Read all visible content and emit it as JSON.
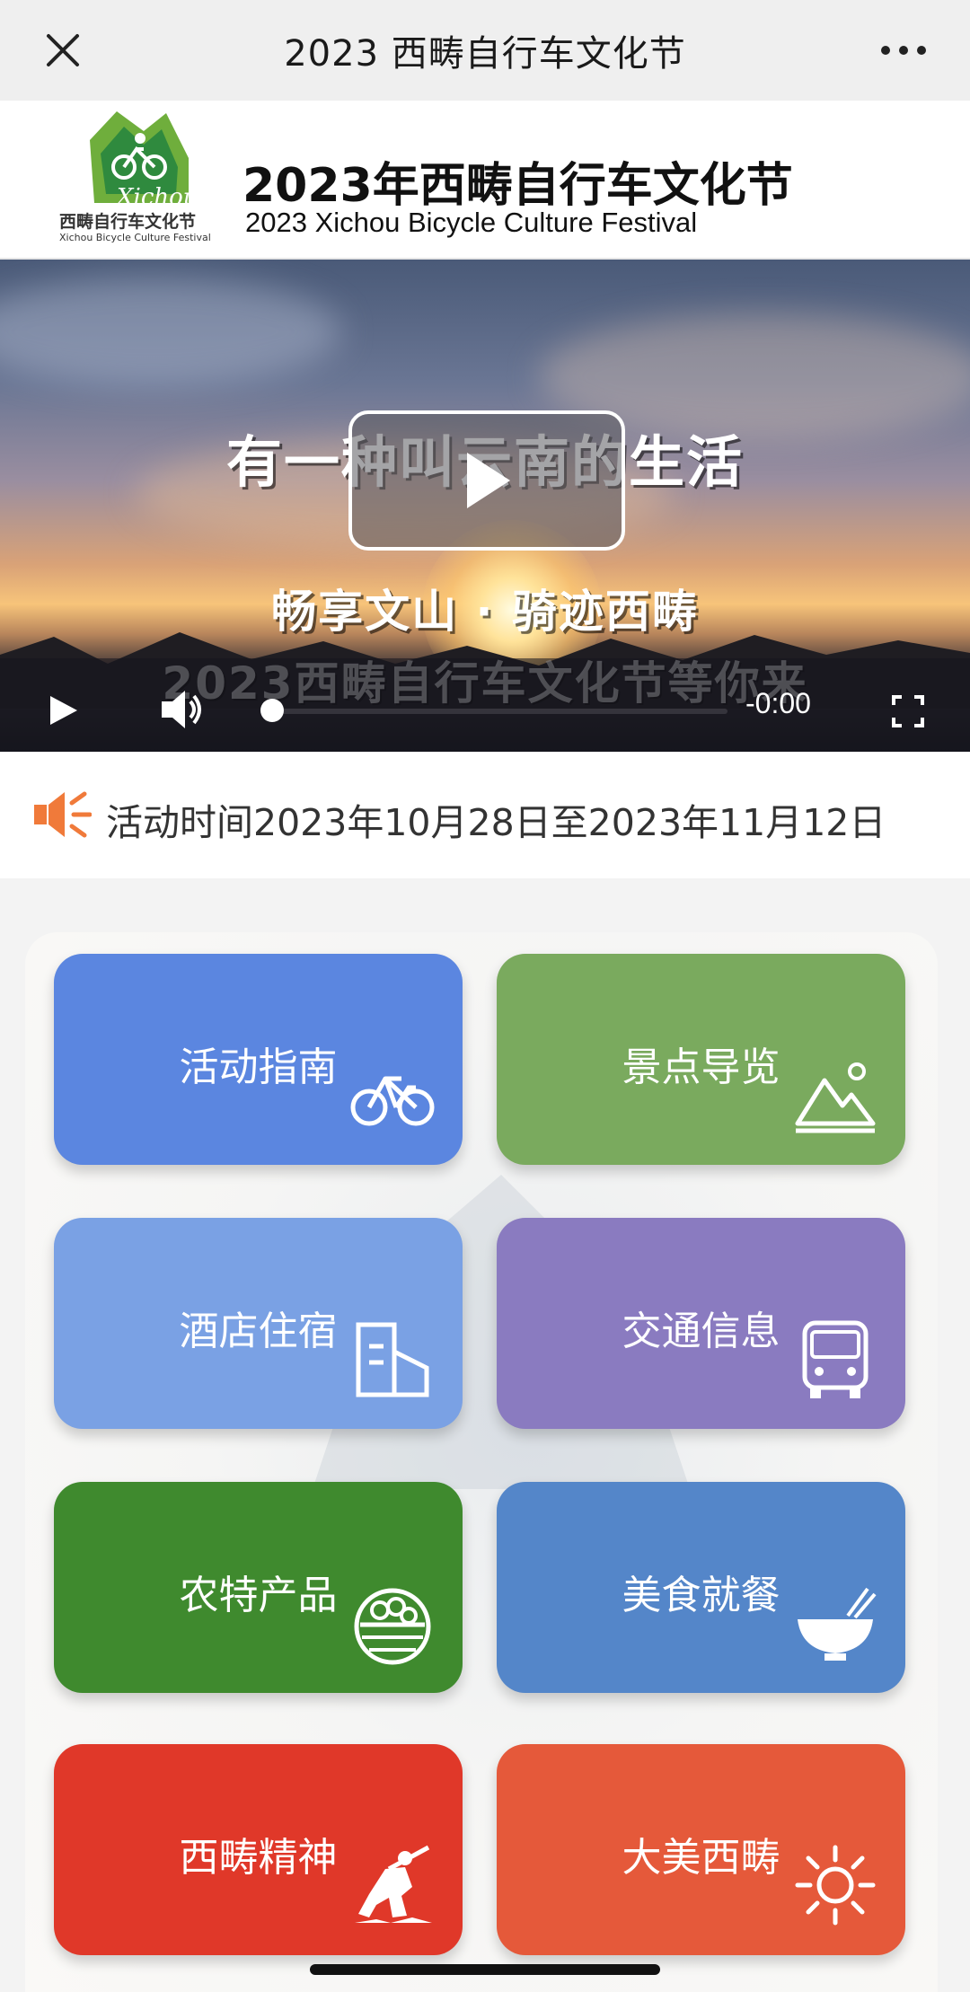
{
  "navbar": {
    "title": "2023 西畴自行车文化节",
    "close_icon": "close-icon",
    "more_icon": "more-icon"
  },
  "header": {
    "logo_caption": "西畴自行车文化节",
    "logo_subcaption": "Xichou Bicycle Culture Festival",
    "title": "2023年西畴自行车文化节",
    "subtitle": "2023 Xichou Bicycle Culture Festival"
  },
  "video": {
    "overlay_line1": "有一种叫云南的生活",
    "overlay_line2": "畅享文山 · 骑迹西畴",
    "overlay_line3": "2023西畴自行车文化节等你来",
    "time": "-0:00",
    "progress": 0
  },
  "notice": {
    "icon": "speaker-icon",
    "text": "活动时间2023年10月28日至2023年11月12日",
    "accent": "#f07a3a"
  },
  "tiles": [
    {
      "label": "活动指南",
      "icon": "bicycle-icon",
      "color": "#5b86e0"
    },
    {
      "label": "景点导览",
      "icon": "mountain-icon",
      "color": "#7aaa5e"
    },
    {
      "label": "酒店住宿",
      "icon": "building-icon",
      "color": "#7aa1e4"
    },
    {
      "label": "交通信息",
      "icon": "bus-icon",
      "color": "#8a7bc0"
    },
    {
      "label": "农特产品",
      "icon": "basket-icon",
      "color": "#3f8a2e"
    },
    {
      "label": "美食就餐",
      "icon": "bowl-icon",
      "color": "#5486c9"
    },
    {
      "label": "西畴精神",
      "icon": "worker-icon",
      "color": "#e03829"
    },
    {
      "label": "大美西畴",
      "icon": "sun-icon",
      "color": "#e5593a"
    }
  ]
}
